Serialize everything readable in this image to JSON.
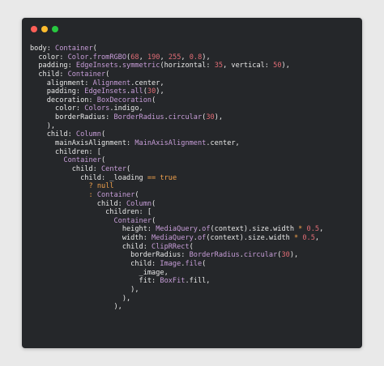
{
  "window": {
    "controls": [
      "close",
      "minimize",
      "maximize"
    ],
    "colors": {
      "close": "#ff5f57",
      "minimize": "#febc2e",
      "maximize": "#28c840",
      "background": "#25272a"
    }
  },
  "code_lines": [
    [
      {
        "t": "body: ",
        "c": "plain"
      },
      {
        "t": "Container",
        "c": "type"
      },
      {
        "t": "(",
        "c": "plain"
      }
    ],
    [
      {
        "t": "  color: ",
        "c": "plain"
      },
      {
        "t": "Color",
        "c": "type"
      },
      {
        "t": ".",
        "c": "plain"
      },
      {
        "t": "fromRGBO",
        "c": "fn"
      },
      {
        "t": "(",
        "c": "plain"
      },
      {
        "t": "68",
        "c": "num"
      },
      {
        "t": ", ",
        "c": "plain"
      },
      {
        "t": "190",
        "c": "num"
      },
      {
        "t": ", ",
        "c": "plain"
      },
      {
        "t": "255",
        "c": "num"
      },
      {
        "t": ", ",
        "c": "plain"
      },
      {
        "t": "0.8",
        "c": "num"
      },
      {
        "t": "),",
        "c": "plain"
      }
    ],
    [
      {
        "t": "  padding: ",
        "c": "plain"
      },
      {
        "t": "EdgeInsets",
        "c": "type"
      },
      {
        "t": ".",
        "c": "plain"
      },
      {
        "t": "symmetric",
        "c": "fn"
      },
      {
        "t": "(horizontal: ",
        "c": "plain"
      },
      {
        "t": "35",
        "c": "num"
      },
      {
        "t": ", vertical: ",
        "c": "plain"
      },
      {
        "t": "50",
        "c": "num"
      },
      {
        "t": "),",
        "c": "plain"
      }
    ],
    [
      {
        "t": "  child: ",
        "c": "plain"
      },
      {
        "t": "Container",
        "c": "type"
      },
      {
        "t": "(",
        "c": "plain"
      }
    ],
    [
      {
        "t": "    alignment: ",
        "c": "plain"
      },
      {
        "t": "Alignment",
        "c": "type"
      },
      {
        "t": ".center,",
        "c": "plain"
      }
    ],
    [
      {
        "t": "    padding: ",
        "c": "plain"
      },
      {
        "t": "EdgeInsets",
        "c": "type"
      },
      {
        "t": ".",
        "c": "plain"
      },
      {
        "t": "all",
        "c": "fn"
      },
      {
        "t": "(",
        "c": "plain"
      },
      {
        "t": "30",
        "c": "num"
      },
      {
        "t": "),",
        "c": "plain"
      }
    ],
    [
      {
        "t": "    decoration: ",
        "c": "plain"
      },
      {
        "t": "BoxDecoration",
        "c": "type"
      },
      {
        "t": "(",
        "c": "plain"
      }
    ],
    [
      {
        "t": "      color: ",
        "c": "plain"
      },
      {
        "t": "Colors",
        "c": "type"
      },
      {
        "t": ".indigo,",
        "c": "plain"
      }
    ],
    [
      {
        "t": "      borderRadius: ",
        "c": "plain"
      },
      {
        "t": "BorderRadius",
        "c": "type"
      },
      {
        "t": ".",
        "c": "plain"
      },
      {
        "t": "circular",
        "c": "fn"
      },
      {
        "t": "(",
        "c": "plain"
      },
      {
        "t": "30",
        "c": "num"
      },
      {
        "t": "),",
        "c": "plain"
      }
    ],
    [
      {
        "t": "    ),",
        "c": "plain"
      }
    ],
    [
      {
        "t": "    child: ",
        "c": "plain"
      },
      {
        "t": "Column",
        "c": "type"
      },
      {
        "t": "(",
        "c": "plain"
      }
    ],
    [
      {
        "t": "      mainAxisAlignment: ",
        "c": "plain"
      },
      {
        "t": "MainAxisAlignment",
        "c": "type"
      },
      {
        "t": ".center,",
        "c": "plain"
      }
    ],
    [
      {
        "t": "      children: [",
        "c": "plain"
      }
    ],
    [
      {
        "t": "        ",
        "c": "plain"
      },
      {
        "t": "Container",
        "c": "type"
      },
      {
        "t": "(",
        "c": "plain"
      }
    ],
    [
      {
        "t": "          child: ",
        "c": "plain"
      },
      {
        "t": "Center",
        "c": "type"
      },
      {
        "t": "(",
        "c": "plain"
      }
    ],
    [
      {
        "t": "            child: _loading ",
        "c": "plain"
      },
      {
        "t": "==",
        "c": "op"
      },
      {
        "t": " ",
        "c": "plain"
      },
      {
        "t": "true",
        "c": "kw"
      }
    ],
    [
      {
        "t": "              ",
        "c": "plain"
      },
      {
        "t": "?",
        "c": "op"
      },
      {
        "t": " ",
        "c": "plain"
      },
      {
        "t": "null",
        "c": "kw"
      }
    ],
    [
      {
        "t": "              ",
        "c": "plain"
      },
      {
        "t": ":",
        "c": "op"
      },
      {
        "t": " ",
        "c": "plain"
      },
      {
        "t": "Container",
        "c": "type"
      },
      {
        "t": "(",
        "c": "plain"
      }
    ],
    [
      {
        "t": "                child: ",
        "c": "plain"
      },
      {
        "t": "Column",
        "c": "type"
      },
      {
        "t": "(",
        "c": "plain"
      }
    ],
    [
      {
        "t": "                  children: [",
        "c": "plain"
      }
    ],
    [
      {
        "t": "                    ",
        "c": "plain"
      },
      {
        "t": "Container",
        "c": "type"
      },
      {
        "t": "(",
        "c": "plain"
      }
    ],
    [
      {
        "t": "                      height: ",
        "c": "plain"
      },
      {
        "t": "MediaQuery",
        "c": "type"
      },
      {
        "t": ".",
        "c": "plain"
      },
      {
        "t": "of",
        "c": "fn"
      },
      {
        "t": "(context).size.width ",
        "c": "plain"
      },
      {
        "t": "*",
        "c": "op"
      },
      {
        "t": " ",
        "c": "plain"
      },
      {
        "t": "0.5",
        "c": "num"
      },
      {
        "t": ",",
        "c": "plain"
      }
    ],
    [
      {
        "t": "                      width: ",
        "c": "plain"
      },
      {
        "t": "MediaQuery",
        "c": "type"
      },
      {
        "t": ".",
        "c": "plain"
      },
      {
        "t": "of",
        "c": "fn"
      },
      {
        "t": "(context).size.width ",
        "c": "plain"
      },
      {
        "t": "*",
        "c": "op"
      },
      {
        "t": " ",
        "c": "plain"
      },
      {
        "t": "0.5",
        "c": "num"
      },
      {
        "t": ",",
        "c": "plain"
      }
    ],
    [
      {
        "t": "                      child: ",
        "c": "plain"
      },
      {
        "t": "ClipRRect",
        "c": "type"
      },
      {
        "t": "(",
        "c": "plain"
      }
    ],
    [
      {
        "t": "                        borderRadius: ",
        "c": "plain"
      },
      {
        "t": "BorderRadius",
        "c": "type"
      },
      {
        "t": ".",
        "c": "plain"
      },
      {
        "t": "circular",
        "c": "fn"
      },
      {
        "t": "(",
        "c": "plain"
      },
      {
        "t": "30",
        "c": "num"
      },
      {
        "t": "),",
        "c": "plain"
      }
    ],
    [
      {
        "t": "                        child: ",
        "c": "plain"
      },
      {
        "t": "Image",
        "c": "type"
      },
      {
        "t": ".",
        "c": "plain"
      },
      {
        "t": "file",
        "c": "fn"
      },
      {
        "t": "(",
        "c": "plain"
      }
    ],
    [
      {
        "t": "                          _image,",
        "c": "plain"
      }
    ],
    [
      {
        "t": "                          fit: ",
        "c": "plain"
      },
      {
        "t": "BoxFit",
        "c": "type"
      },
      {
        "t": ".fill,",
        "c": "plain"
      }
    ],
    [
      {
        "t": "                        ),",
        "c": "plain"
      }
    ],
    [
      {
        "t": "                      ),",
        "c": "plain"
      }
    ],
    [
      {
        "t": "                    ),",
        "c": "plain"
      }
    ]
  ],
  "syntax_colors": {
    "plain": "#e8e8e8",
    "type": "#c79dd8",
    "fn": "#c79dd8",
    "num": "#e06c75",
    "kw": "#f0a14c",
    "op": "#f0a14c"
  }
}
